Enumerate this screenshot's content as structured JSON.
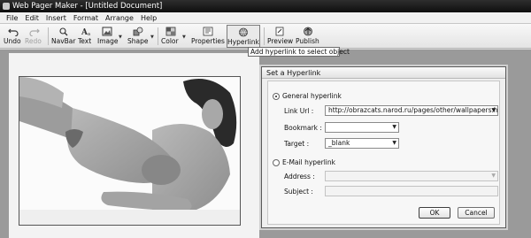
{
  "window": {
    "title": "Web Pager Maker - [Untitled Document]"
  },
  "menu": [
    "File",
    "Edit",
    "Insert",
    "Format",
    "Arrange",
    "Help"
  ],
  "toolbar": {
    "undo": "Undo",
    "redo": "Redo",
    "navbar": "NavBar",
    "text": "Text",
    "image": "Image",
    "shape": "Shape",
    "color": "Color",
    "properties": "Properties",
    "hyperlink": "Hyperlink",
    "preview": "Preview",
    "publish": "Publish"
  },
  "tooltip": "Add hyperlink to select object",
  "dialog": {
    "title": "Set a Hyperlink",
    "general_label": "General hyperlink",
    "link_url_label": "Link Url :",
    "link_url_value": "http://obrazcats.narod.ru/pages/other/wallpapers.html",
    "bookmark_label": "Bookmark :",
    "bookmark_value": "",
    "target_label": "Target :",
    "target_value": "_blank",
    "email_label": "E-Mail hyperlink",
    "address_label": "Address :",
    "address_value": "",
    "subject_label": "Subject :",
    "subject_value": "",
    "ok": "OK",
    "cancel": "Cancel"
  }
}
